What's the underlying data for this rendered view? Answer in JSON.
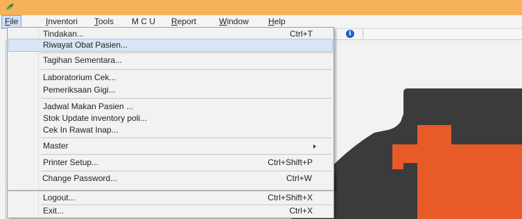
{
  "colors": {
    "titlebar": "#f5b25b",
    "logo_dark": "#3c3c3c",
    "logo_orange": "#ea5a2a",
    "menu_highlight": "#d9e5f5"
  },
  "menubar": {
    "items": [
      {
        "prefix": "",
        "mnemonic": "F",
        "rest": "ile"
      },
      {
        "prefix": "",
        "mnemonic": "I",
        "rest": "nventori"
      },
      {
        "prefix": "",
        "mnemonic": "T",
        "rest": "ools"
      },
      {
        "prefix": "M C U",
        "mnemonic": "",
        "rest": ""
      },
      {
        "prefix": "",
        "mnemonic": "R",
        "rest": "eport"
      },
      {
        "prefix": "",
        "mnemonic": "W",
        "rest": "indow"
      },
      {
        "prefix": "",
        "mnemonic": "H",
        "rest": "elp"
      }
    ]
  },
  "file_menu": {
    "items": [
      {
        "label": "Tindakan...",
        "shortcut": "Ctrl+T"
      },
      {
        "label": "Riwayat Obat Pasien...",
        "shortcut": ""
      },
      {
        "label": "Tagihan Sementara...",
        "shortcut": ""
      },
      {
        "label": "Laboratorium Cek...",
        "shortcut": ""
      },
      {
        "label": "Pemeriksaan Gigi...",
        "shortcut": ""
      },
      {
        "label": "Jadwal Makan Pasien ...",
        "shortcut": ""
      },
      {
        "label": "Stok Update inventory poli...",
        "shortcut": ""
      },
      {
        "label": "Cek In Rawat Inap...",
        "shortcut": ""
      },
      {
        "label": "Master",
        "shortcut": ""
      },
      {
        "label": "Printer Setup...",
        "shortcut": "Ctrl+Shift+P"
      },
      {
        "label": "Change Password...",
        "shortcut": "Ctrl+W"
      },
      {
        "label": "Logout...",
        "shortcut": "Ctrl+Shift+X"
      },
      {
        "label": "Exit...",
        "shortcut": "Ctrl+X"
      }
    ],
    "highlighted_item": "Riwayat Obat Pasien..."
  },
  "icons": {
    "app": "app-leaf-icon",
    "info": "info-icon",
    "submenu": "submenu-arrow-icon",
    "logo": "medical-cross-logo"
  }
}
